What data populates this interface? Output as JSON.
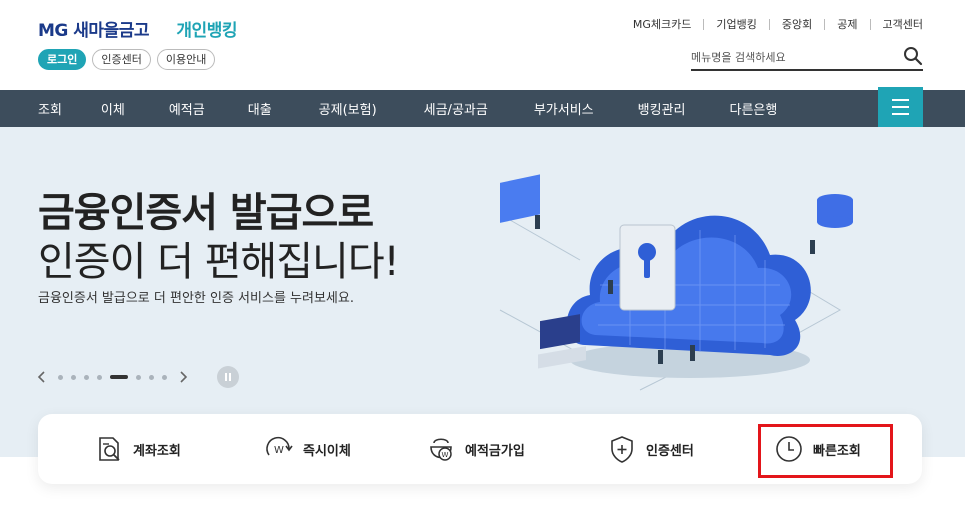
{
  "header": {
    "logo_mg": "MG",
    "logo_name": "새마을금고",
    "logo_sub": "개인뱅킹",
    "pills": [
      "로그인",
      "인증센터",
      "이용안내"
    ],
    "util_links": [
      "MG체크카드",
      "기업뱅킹",
      "중앙회",
      "공제",
      "고객센터"
    ],
    "search_placeholder": "메뉴명을 검색하세요"
  },
  "nav": {
    "items": [
      "조회",
      "이체",
      "예적금",
      "대출",
      "공제(보험)",
      "세금/공과금",
      "부가서비스",
      "뱅킹관리",
      "다른은행"
    ]
  },
  "banner": {
    "headline_bold": "금융인증서 발급으로",
    "headline_light": "인증이 더 편해집니다!",
    "description": "금융인증서 발급으로 더 편안한 인증 서비스를 누려보세요.",
    "carousel_total": 8,
    "carousel_active": 5
  },
  "quick_menu": [
    {
      "label": "계좌조회",
      "icon": "account-inquiry-icon"
    },
    {
      "label": "즉시이체",
      "icon": "instant-transfer-icon"
    },
    {
      "label": "예적금가입",
      "icon": "savings-join-icon"
    },
    {
      "label": "인증센터",
      "icon": "shield-plus-icon"
    },
    {
      "label": "빠른조회",
      "icon": "clock-icon"
    }
  ],
  "colors": {
    "brand_navy": "#1b3a8a",
    "brand_teal": "#1fa4b5",
    "nav_bg": "#3d4d5c",
    "banner_bg": "#e6eef4",
    "highlight_red": "#e3151a"
  }
}
